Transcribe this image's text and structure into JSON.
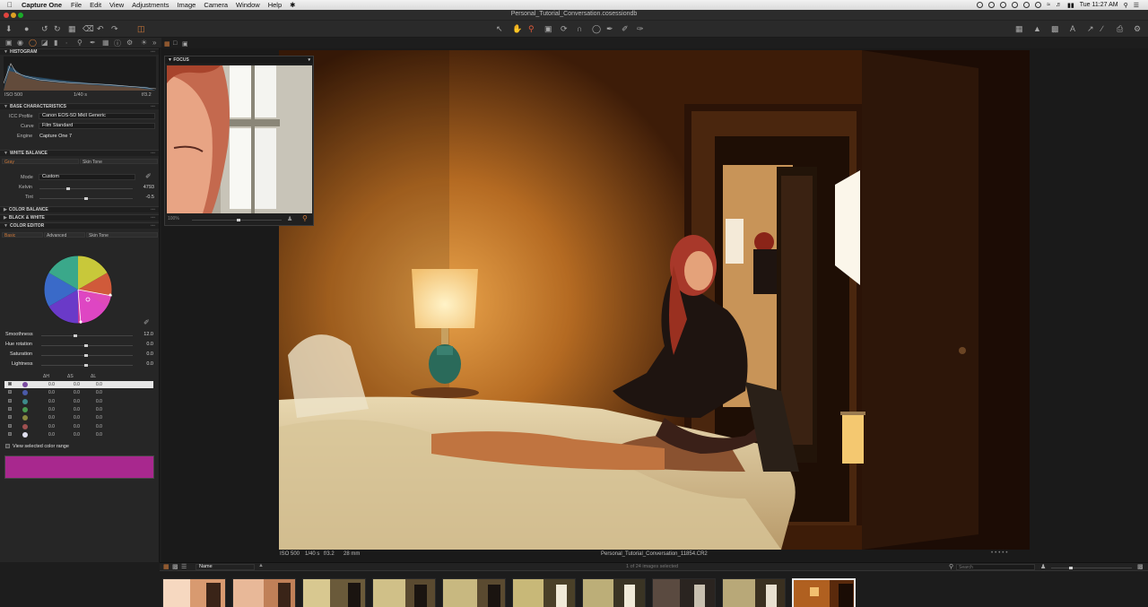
{
  "menubar": {
    "app_name": "Capture One",
    "items": [
      "File",
      "Edit",
      "View",
      "Adjustments",
      "Image",
      "Camera",
      "Window",
      "Help"
    ],
    "clock": "Tue 11:27 AM"
  },
  "window": {
    "title": "Personal_Tutorial_Conversation.cosessiondb"
  },
  "histogram": {
    "header": "HISTOGRAM",
    "iso": "ISO 500",
    "shutter": "1/40 s",
    "aperture": "f/3.2"
  },
  "base_characteristics": {
    "header": "BASE CHARACTERISTICS",
    "icc_label": "ICC Profile",
    "icc_value": "Canon EOS-5D MkII Generic",
    "curve_label": "Curve",
    "curve_value": "Film Standard",
    "engine_label": "Engine",
    "engine_value": "Capture One 7"
  },
  "white_balance": {
    "header": "WHITE BALANCE",
    "tab_gray": "Gray",
    "tab_skin": "Skin Tone",
    "mode_label": "Mode",
    "mode_value": "Custom",
    "kelvin_label": "Kelvin",
    "kelvin_value": "4793",
    "tint_label": "Tint",
    "tint_value": "-0.5"
  },
  "collapsed_sections": {
    "color_balance": "COLOR BALANCE",
    "black_white": "BLACK & WHITE"
  },
  "color_editor": {
    "header": "COLOR EDITOR",
    "tabs": [
      "Basic",
      "Advanced",
      "Skin Tone"
    ],
    "smoothness_label": "Smoothness",
    "smoothness_value": "12.0",
    "hue_label": "Hue rotation",
    "hue_value": "0.0",
    "saturation_label": "Saturation",
    "saturation_value": "0.0",
    "lightness_label": "Lightness",
    "lightness_value": "0.0",
    "col_dh": "ΔH",
    "col_ds": "ΔS",
    "col_dl": "ΔL",
    "rows": [
      {
        "color": "#7a4aa0",
        "h": "0.0",
        "s": "0.0",
        "l": "0.0"
      },
      {
        "color": "#4a5aa8",
        "h": "0.0",
        "s": "0.0",
        "l": "0.0"
      },
      {
        "color": "#3d8a8a",
        "h": "0.0",
        "s": "0.0",
        "l": "0.0"
      },
      {
        "color": "#4a9a50",
        "h": "0.0",
        "s": "0.0",
        "l": "0.0"
      },
      {
        "color": "#8a8a40",
        "h": "0.0",
        "s": "0.0",
        "l": "0.0"
      },
      {
        "color": "#a05050",
        "h": "0.0",
        "s": "0.0",
        "l": "0.0"
      },
      {
        "color": "#e0e0f0",
        "h": "0.0",
        "s": "0.0",
        "l": "0.0"
      }
    ],
    "view_range_label": "View selected color range",
    "range_color": "#a8288e"
  },
  "focus": {
    "header": "FOCUS",
    "zoom": "100%"
  },
  "viewer": {
    "iso": "ISO 500",
    "shutter": "1/40 s",
    "aperture": "f/3.2",
    "focal": "28 mm",
    "filename": "Personal_Tutorial_Conversation_11854.CR2"
  },
  "filmbar": {
    "sort_value": "Name",
    "selection_text": "1 of 24 images selected",
    "search_placeholder": "Search"
  }
}
